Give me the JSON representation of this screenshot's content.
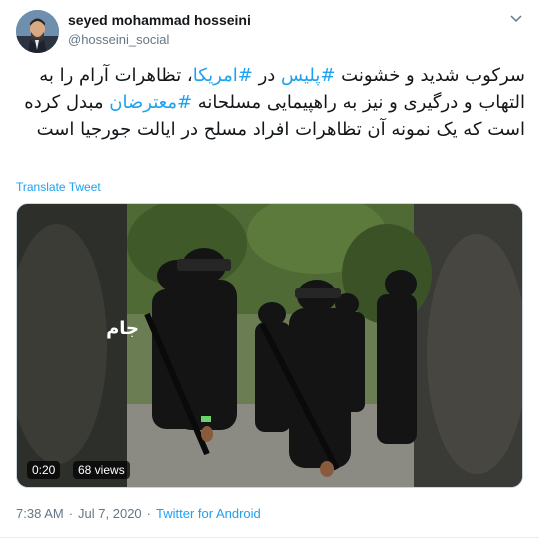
{
  "user": {
    "display_name": "seyed mohammad hosseini",
    "handle": "@hosseini_social",
    "avatar_icon": "user-avatar-photo"
  },
  "menu_icon": "chevron-down-icon",
  "tweet": {
    "segments": [
      {
        "text": "سرکوب شدید و خشونت ",
        "type": "text"
      },
      {
        "text": "#پلیس",
        "type": "hashtag"
      },
      {
        "text": " در ",
        "type": "text"
      },
      {
        "text": "#امریکا",
        "type": "hashtag"
      },
      {
        "text": "، تظاهرات آرام را به التهاب و درگیری و نیز به راهپیمایی مسلحانه ",
        "type": "text"
      },
      {
        "text": "#معترضان",
        "type": "hashtag"
      },
      {
        "text": " مبدل کرده است که یک نمونه  آن تظاهرات افراد مسلح در ایالت جورجیا است",
        "type": "text"
      }
    ],
    "hashtag_color": "#1da1f2"
  },
  "translate_label": "Translate Tweet",
  "media": {
    "type": "video",
    "duration": "0:20",
    "views": "68 views",
    "watermark": "جام"
  },
  "meta": {
    "time": "7:38 AM",
    "separator": "·",
    "date": "Jul 7, 2020",
    "source": "Twitter for Android"
  },
  "colors": {
    "link": "#1da1f2",
    "secondary_text": "#657786",
    "primary_text": "#14171a"
  }
}
